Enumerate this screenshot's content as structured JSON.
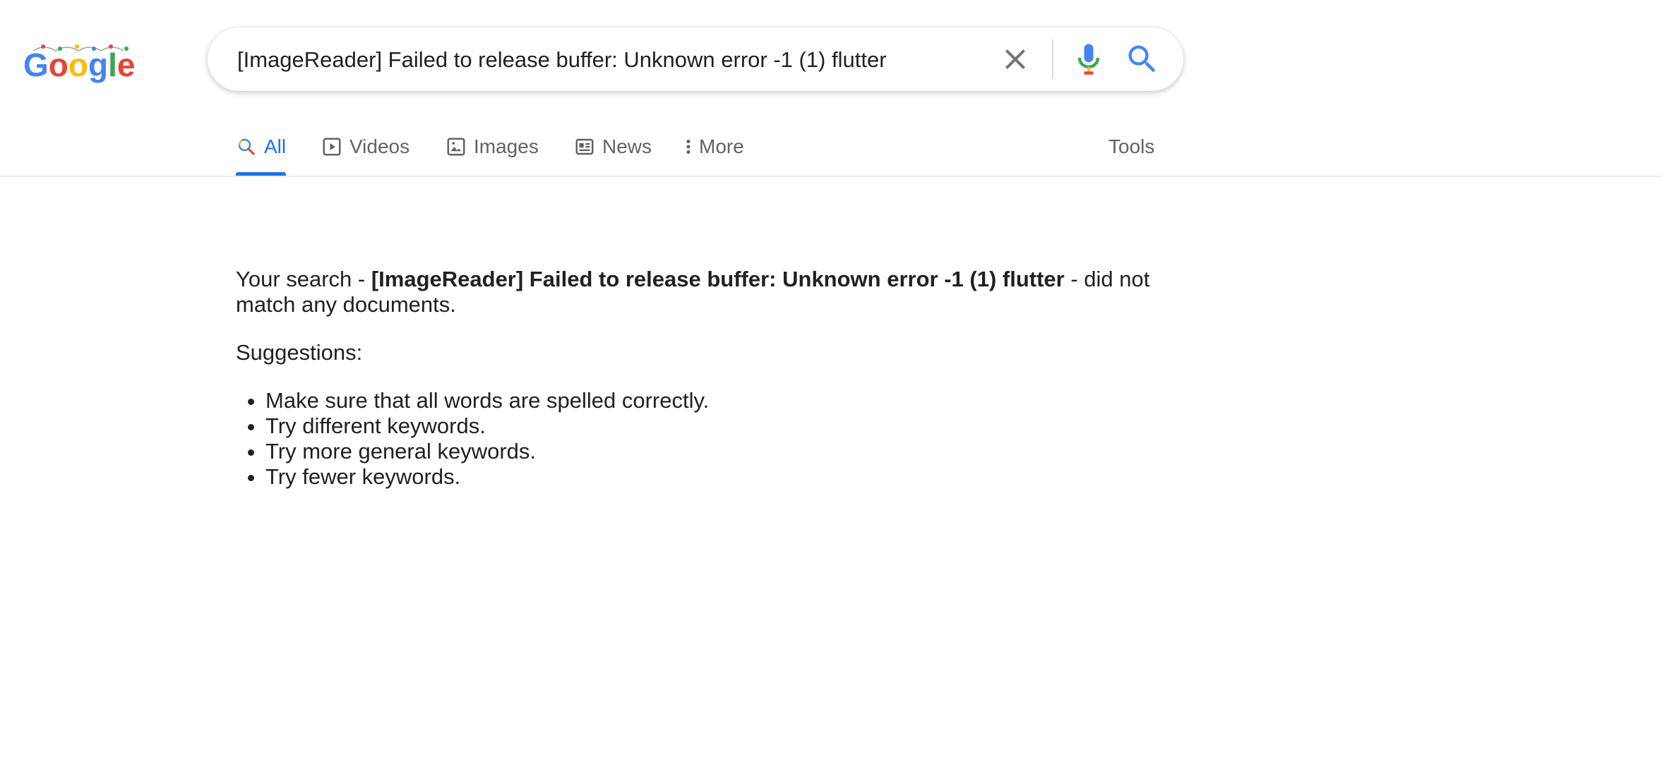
{
  "search": {
    "query": "[ImageReader] Failed to release buffer: Unknown error -1 (1) flutter",
    "clear_icon": "close-icon",
    "mic_icon": "microphone-icon",
    "search_icon": "search-icon"
  },
  "logo": {
    "text": "Google",
    "colors": [
      "#4285F4",
      "#EA4335",
      "#FBBC05",
      "#4285F4",
      "#34A853",
      "#EA4335"
    ]
  },
  "tabs": [
    {
      "label": "All",
      "icon": "search-icon",
      "active": true
    },
    {
      "label": "Videos",
      "icon": "play-icon"
    },
    {
      "label": "Images",
      "icon": "image-icon"
    },
    {
      "label": "News",
      "icon": "news-icon"
    },
    {
      "label": "More",
      "icon": "more-vertical-icon"
    }
  ],
  "tools_label": "Tools",
  "results": {
    "prefix": "Your search - ",
    "query": "[ImageReader] Failed to release buffer: Unknown error -1 (1) flutter",
    "suffix": " - did not match any documents.",
    "suggestions_title": "Suggestions:",
    "suggestions": [
      "Make sure that all words are spelled correctly.",
      "Try different keywords.",
      "Try more general keywords.",
      "Try fewer keywords."
    ]
  },
  "colors": {
    "accent": "#1a73e8",
    "text": "#202124",
    "muted": "#5f6368"
  }
}
